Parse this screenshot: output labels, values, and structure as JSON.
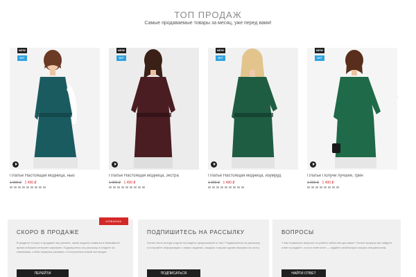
{
  "section": {
    "title": "ТОП ПРОДАЖ",
    "subtitle": "Самые продаваемые товары за месяц, уже перед вами!"
  },
  "carousel": {
    "prev_icon": "chevron-left-icon",
    "next_icon": "chevron-right-icon",
    "prev_label": "‹",
    "next_label": "›"
  },
  "products": [
    {
      "name": "Платье Настоящая модница, нью",
      "price_old": "1 990 ₽",
      "price_new": "1 490 ₽",
      "badge_new": "NEW",
      "badge_hit": "HIT",
      "dress_color": "#1a5b60",
      "background_color": "#f3f3f3"
    },
    {
      "name": "Платье Настоящая модница, экстра",
      "price_old": "1 990 ₽",
      "price_new": "1 490 ₽",
      "badge_new": "NEW",
      "badge_hit": "HIT",
      "dress_color": "#4a1d22",
      "background_color": "#ececec"
    },
    {
      "name": "Платье Настоящая модница, изумруд",
      "price_old": "1 990 ₽",
      "price_new": "1 490 ₽",
      "badge_new": "NEW",
      "badge_hit": "HIT",
      "dress_color": "#1f5d43",
      "background_color": "#f1f1f1"
    },
    {
      "name": "Платье Получи лучшее, грин",
      "price_old": "1 990 ₽",
      "price_new": "1 490 ₽",
      "badge_new": "NEW",
      "badge_hit": "HIT",
      "dress_color": "#1f6a48",
      "background_color": "#f5f5f5"
    }
  ],
  "info_blocks": {
    "soon": {
      "ribbon": "НОВИНКА",
      "title": "СКОРО В ПРОДАЖЕ",
      "text": "В разделе «Скоро в продаже» вы узнаете, какие модели появятся в ближайшее время в Вашем интернет-магазине. Подпишитесь на рассылку и следите за новинками, чтобы первыми узнавать о поступлении новой коллекции.",
      "button": "ПЕРЕЙТИ"
    },
    "subscribe": {
      "title": "ПОДПИШИТЕСЬ НА РАССЫЛКУ",
      "text": "Хотите быть всегда в курсе последних предложений от нас? Подпишитесь на рассылку и получайте информацию о новых моделях, скидках и акциях одним письмом на почту.",
      "button": "ПОДПИСАТЬСЯ"
    },
    "questions": {
      "title": "ВОПРОСЫ",
      "text": "У вас появились вопросы по работе сайта или доставке? На все вопросы вы найдете ответ в разделе, а если ответа нет — задайте свой вопрос нашим специалистам.",
      "button": "НАЙТИ ОТВЕТ"
    }
  },
  "colors": {
    "accent_red": "#d42828",
    "badge_hit_blue": "#2fa2df",
    "button_dark": "#1f1f1f"
  }
}
